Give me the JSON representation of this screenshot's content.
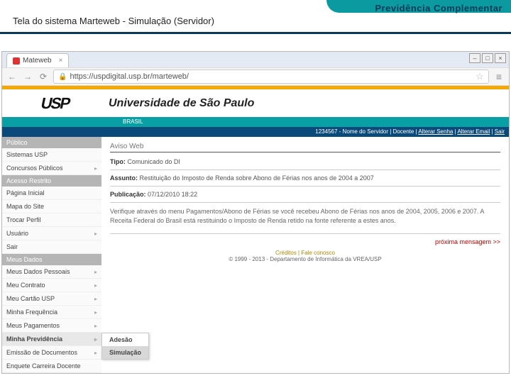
{
  "slide": {
    "left_title": "Tela do sistema Marteweb - Simulação (Servidor)",
    "right_title": "Previdência Complementar"
  },
  "browser": {
    "tab_name": "Mateweb",
    "url": "https://uspdigital.usp.br/marteweb/"
  },
  "site": {
    "logo_text": "USP",
    "univ_name": "Universidade de São Paulo",
    "brasil": "BRASIL"
  },
  "userbar": {
    "info": "1234567 - Nome do Servidor | Docente",
    "links": [
      "Alterar Senha",
      "Alterar Email",
      "Sair"
    ]
  },
  "sidebar": {
    "sections": [
      {
        "head": "Público",
        "items": [
          {
            "label": "Sistemas USP",
            "arrow": false
          },
          {
            "label": "Concursos Públicos",
            "arrow": true
          }
        ]
      },
      {
        "head": "Acesso Restrito",
        "items": [
          {
            "label": "Página Inicial",
            "arrow": false
          },
          {
            "label": "Mapa do Site",
            "arrow": false
          },
          {
            "label": "Trocar Perfil",
            "arrow": false
          },
          {
            "label": "Usuário",
            "arrow": true
          },
          {
            "label": "Sair",
            "arrow": false
          }
        ]
      },
      {
        "head": "Meus Dados",
        "items": [
          {
            "label": "Meus Dados Pessoais",
            "arrow": true
          },
          {
            "label": "Meu Contrato",
            "arrow": true
          },
          {
            "label": "Meu Cartão USP",
            "arrow": true
          },
          {
            "label": "Minha Frequência",
            "arrow": true
          },
          {
            "label": "Meus Pagamentos",
            "arrow": true
          },
          {
            "label": "Minha Previdência",
            "arrow": true,
            "selected": true,
            "submenu": [
              "Adesão",
              "Simulação"
            ]
          },
          {
            "label": "Emissão de Documentos",
            "arrow": true
          },
          {
            "label": "Enquete Carreira Docente",
            "arrow": false
          }
        ]
      }
    ]
  },
  "main": {
    "aviso": "Aviso Web",
    "tipo_label": "Tipo:",
    "tipo_value": "Comunicado do DI",
    "assunto_label": "Assunto:",
    "assunto_value": "Restituição do Imposto de Renda sobre Abono de Férias nos anos de 2004 a 2007",
    "pub_label": "Publicação:",
    "pub_value": "07/12/2010 18:22",
    "body": "Verifique através do menu Pagamentos/Abono de Férias se você recebeu Abono de Férias nos anos de 2004, 2005, 2006 e 2007. A Receita Federal do Brasil está restituindo o Imposto de Renda retido na fonte referente a estes anos.",
    "next": "próxima mensagem >>",
    "footer_links": "Créditos | Fale conosco",
    "copyright": "© 1999 - 2013 - Departamento de Informática da VREA/USP"
  }
}
